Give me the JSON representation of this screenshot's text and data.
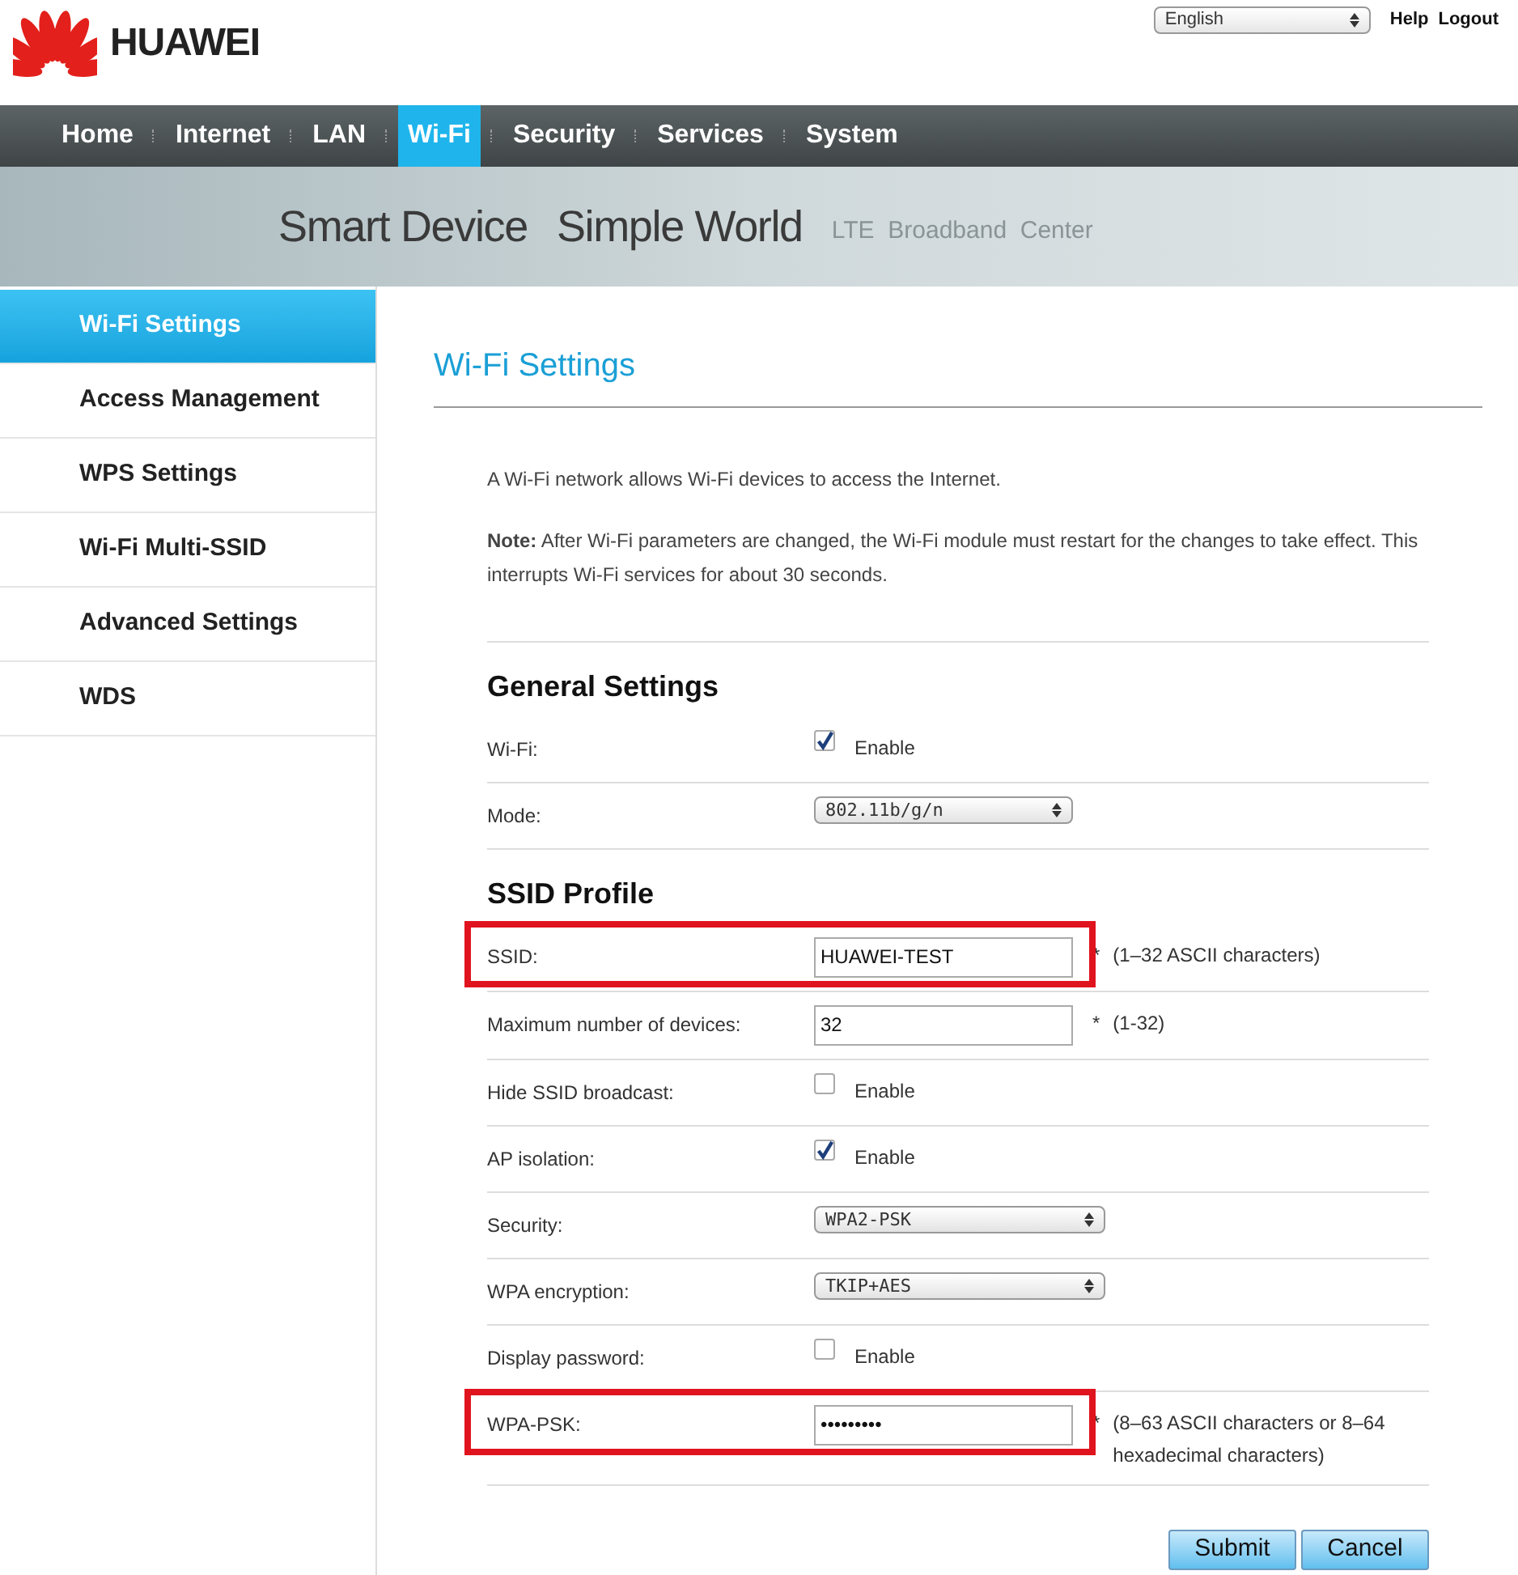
{
  "header": {
    "logo": "HUAWEI",
    "language": "English",
    "links": [
      "Help",
      "Logout"
    ]
  },
  "nav": [
    {
      "label": "Home",
      "selected": false
    },
    {
      "label": "Internet",
      "selected": false
    },
    {
      "label": "LAN",
      "selected": false
    },
    {
      "label": "Wi-Fi",
      "selected": true
    },
    {
      "label": "Security",
      "selected": false
    },
    {
      "label": "Services",
      "selected": false
    },
    {
      "label": "System",
      "selected": false
    }
  ],
  "banner": {
    "slogan": [
      "Smart Device",
      "Simple World"
    ],
    "subtitle": "LTE  Broadband  Center"
  },
  "sidebar": {
    "items": [
      {
        "label": "Wi-Fi Settings",
        "selected": true
      },
      {
        "label": "Access Management",
        "selected": false
      },
      {
        "label": "WPS Settings",
        "selected": false
      },
      {
        "label": "Wi-Fi Multi-SSID",
        "selected": false
      },
      {
        "label": "Advanced Settings",
        "selected": false
      },
      {
        "label": "WDS",
        "selected": false
      }
    ]
  },
  "content": {
    "title": "Wi-Fi Settings",
    "intro": "A Wi-Fi network allows Wi-Fi devices to access the Internet.",
    "note": "**Note:** After Wi-Fi parameters are changed, the Wi-Fi module must restart for the changes to take effect. This interrupts Wi-Fi services for about 30 seconds.",
    "sections": [
      {
        "title": "General Settings",
        "rows": [
          {
            "kind": "checkbox",
            "label": "Wi-Fi:",
            "checked": true,
            "option": "Enable",
            "highlighted": false
          },
          {
            "kind": "select",
            "label": "Mode:",
            "value": "802.11b/g/n",
            "highlighted": false
          }
        ]
      },
      {
        "title": "SSID Profile",
        "rows": [
          {
            "kind": "text",
            "label": "SSID:",
            "value": "HUAWEI-TEST",
            "required": "*",
            "hint": "(1–32 ASCII characters)",
            "highlighted": true
          },
          {
            "kind": "text",
            "label": "Maximum number of devices:",
            "value": "32",
            "required": "*",
            "hint": "(1-32)",
            "highlighted": false
          },
          {
            "kind": "checkbox",
            "label": "Hide SSID broadcast:",
            "checked": false,
            "option": "Enable",
            "highlighted": false
          },
          {
            "kind": "checkbox",
            "label": "AP isolation:",
            "checked": true,
            "option": "Enable",
            "highlighted": false
          },
          {
            "kind": "select",
            "label": "Security:",
            "value": "WPA2-PSK",
            "highlighted": false
          },
          {
            "kind": "select",
            "label": "WPA encryption:",
            "value": "TKIP+AES",
            "highlighted": false
          },
          {
            "kind": "checkbox",
            "label": "Display password:",
            "checked": false,
            "option": "Enable",
            "highlighted": false
          },
          {
            "kind": "text",
            "label": "WPA-PSK:",
            "value": "•••••••••",
            "required": "*",
            "hint": "(8–63 ASCII characters or 8–64 hexadecimal characters)",
            "highlighted": true
          }
        ]
      }
    ],
    "buttons": [
      "Submit",
      "Cancel"
    ]
  }
}
